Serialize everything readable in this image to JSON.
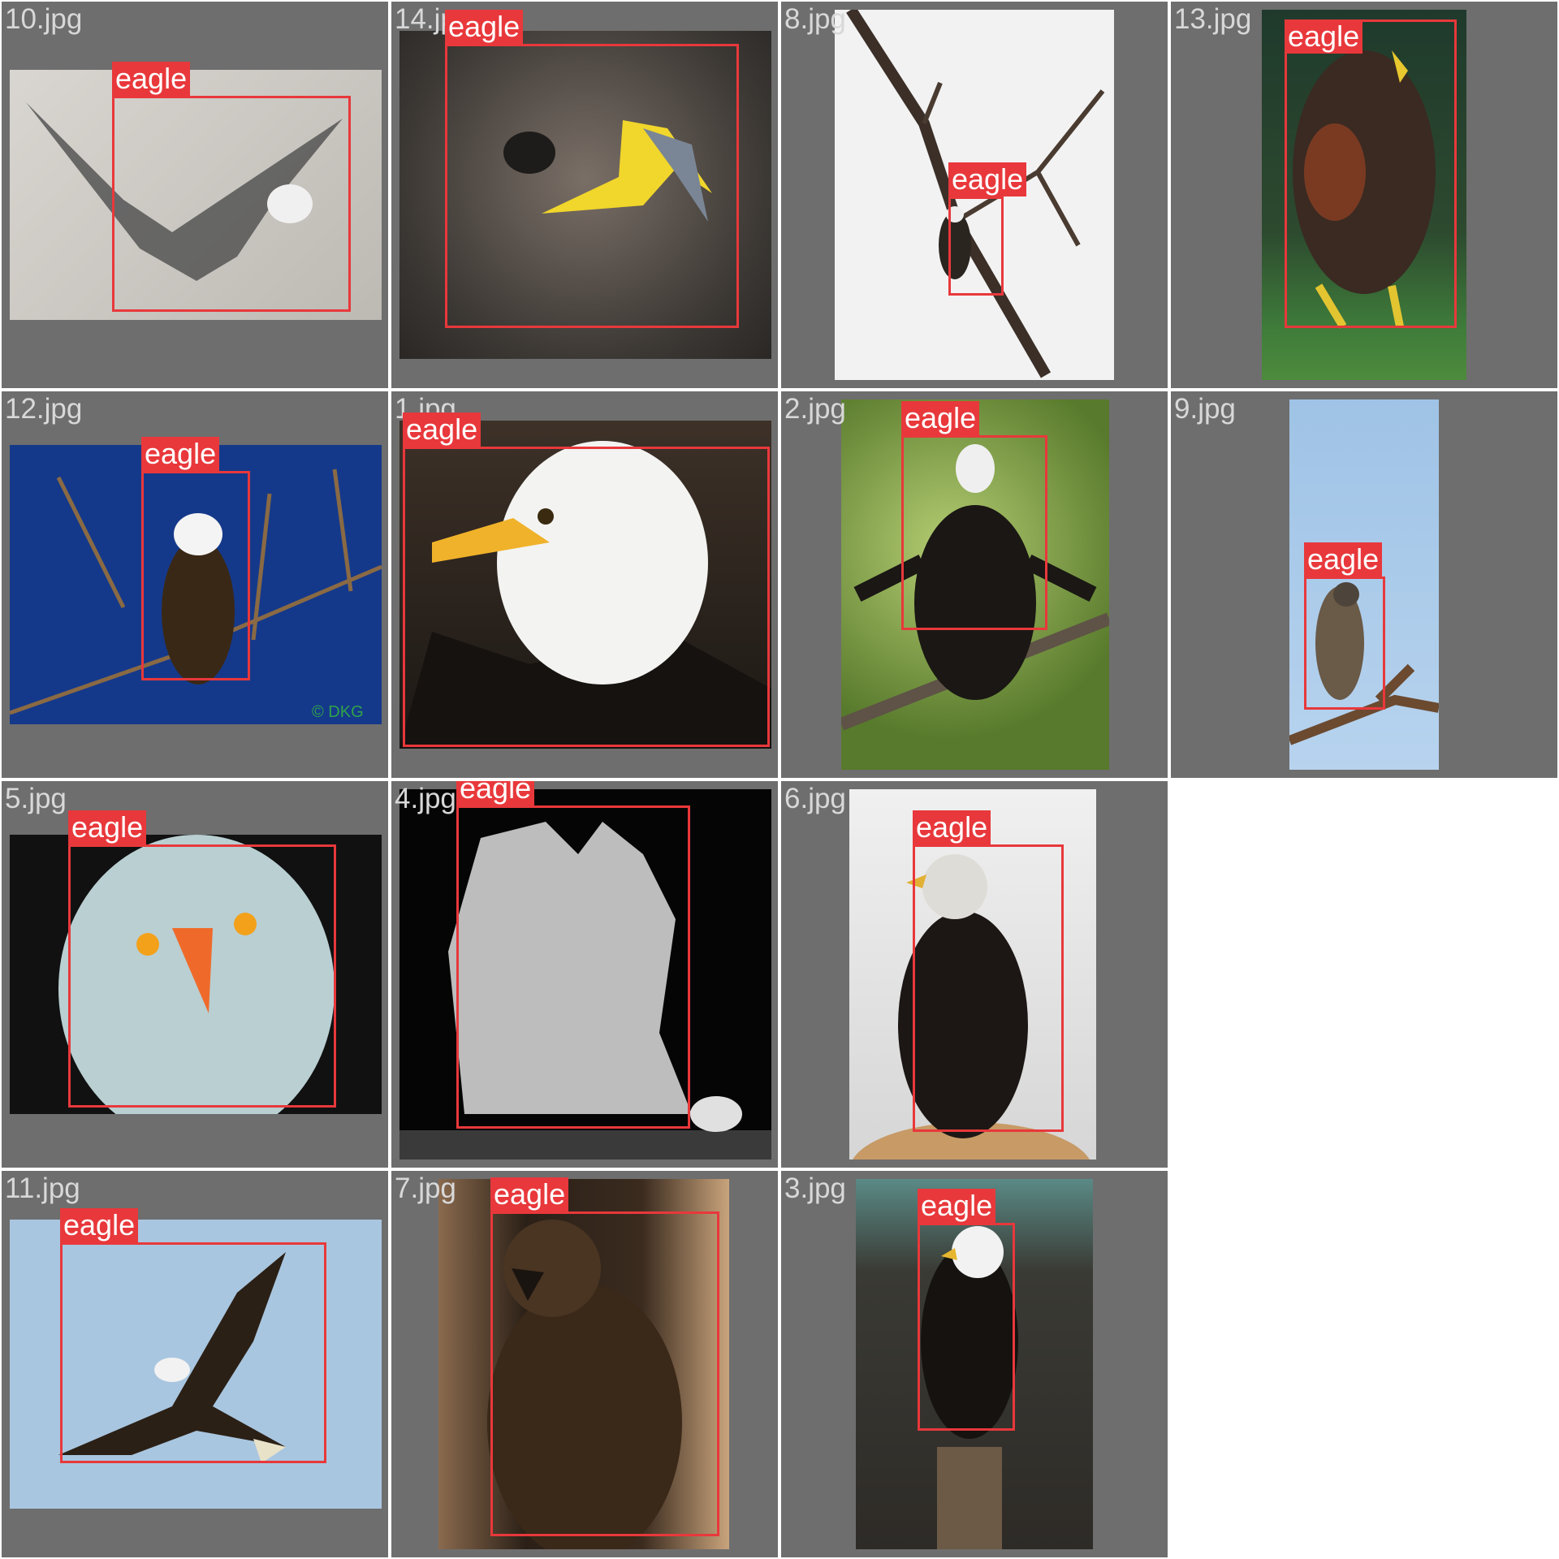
{
  "colors": {
    "tile_background": "#6e6e6e",
    "box": "#e8383b",
    "tag_text": "#ffffff",
    "filename_text": "#d8d8d8"
  },
  "tiles": [
    {
      "filename": "10.jpg",
      "label": "eagle"
    },
    {
      "filename": "14.jpg",
      "label": "eagle"
    },
    {
      "filename": "8.jpg",
      "label": "eagle"
    },
    {
      "filename": "13.jpg",
      "label": "eagle"
    },
    {
      "filename": "12.jpg",
      "label": "eagle"
    },
    {
      "filename": "1.jpg",
      "label": "eagle"
    },
    {
      "filename": "2.jpg",
      "label": "eagle"
    },
    {
      "filename": "9.jpg",
      "label": "eagle"
    },
    {
      "filename": "5.jpg",
      "label": "eagle"
    },
    {
      "filename": "4.jpg",
      "label": "eagle"
    },
    {
      "filename": "6.jpg",
      "label": "eagle"
    },
    {
      "filename": "11.jpg",
      "label": "eagle"
    },
    {
      "filename": "7.jpg",
      "label": "eagle"
    },
    {
      "filename": "3.jpg",
      "label": "eagle"
    }
  ]
}
